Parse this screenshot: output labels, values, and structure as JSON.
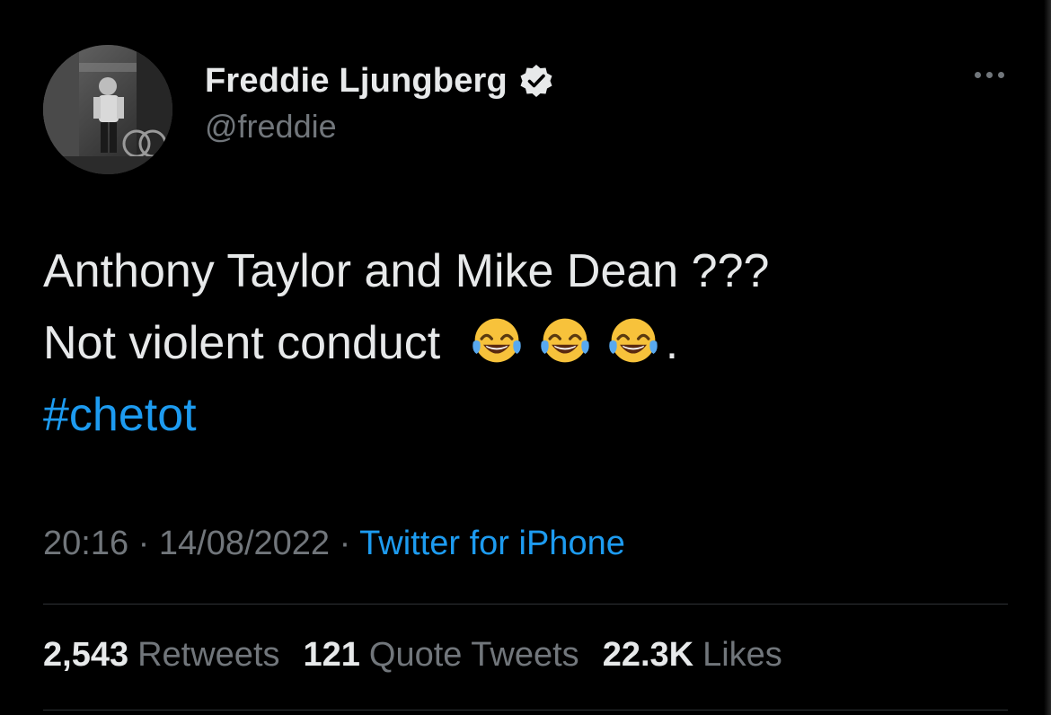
{
  "author": {
    "display_name": "Freddie Ljungberg",
    "handle": "@freddie",
    "verified": true
  },
  "icons": {
    "verified": "verified-badge-icon",
    "more": "more-options-icon",
    "emoji": "face-with-tears-of-joy-icon"
  },
  "tweet": {
    "line1": "Anthony Taylor and Mike Dean ???",
    "line2_text": "Not violent conduct",
    "line2_trailing": ".",
    "emoji_count": 3,
    "hashtag": "#chetot"
  },
  "meta": {
    "time": "20:16",
    "separator1": " · ",
    "date": "14/08/2022",
    "separator2": " · ",
    "source": "Twitter for iPhone"
  },
  "stats": [
    {
      "count": "2,543",
      "label": "Retweets"
    },
    {
      "count": "121",
      "label": "Quote Tweets"
    },
    {
      "count": "22.3K",
      "label": "Likes"
    }
  ],
  "colors": {
    "background": "#000000",
    "text_primary": "#e7e9ea",
    "text_secondary": "#71767b",
    "link": "#1d9bf0",
    "divider": "#2f3336"
  }
}
